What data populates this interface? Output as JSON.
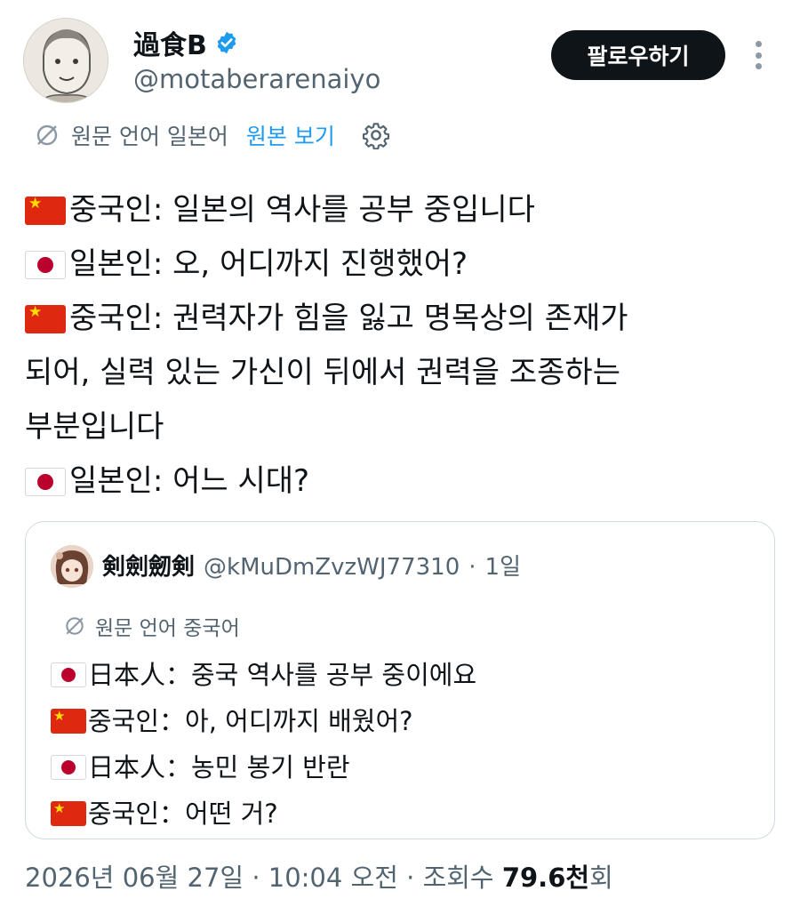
{
  "author": {
    "display_name": "過食B",
    "handle": "@motaberarenaiyo",
    "verified": true,
    "avatar_icon": "avatar-sketch"
  },
  "actions": {
    "follow_label": "팔로우하기",
    "more_icon": "more-vertical-icon"
  },
  "translation": {
    "label": "원문 언어 일본어",
    "show_original": "원본 보기",
    "icon": "no-translate-icon",
    "settings_icon": "gear-icon"
  },
  "tweet": {
    "lines": [
      {
        "flag": "china",
        "text": "중국인: 일본의 역사를 공부 중입니다"
      },
      {
        "flag": "japan",
        "text": "일본인: 오, 어디까지 진행했어?"
      },
      {
        "flag": "china",
        "text": "중국인: 권력자가 힘을 잃고 명목상의 존재가"
      },
      {
        "flag": "",
        "text": "되어, 실력 있는 가신이 뒤에서 권력을 조종하는"
      },
      {
        "flag": "",
        "text": "부분입니다"
      },
      {
        "flag": "japan",
        "text": "일본인: 어느 시대?"
      }
    ]
  },
  "quote": {
    "name": "剣劍劒剣",
    "handle": "@kMuDmZvzWJ77310",
    "separator": "·",
    "time": "1일",
    "translation_label": "원문 언어 중국어",
    "lines": [
      {
        "flag": "japan",
        "text": "日本人：중국 역사를 공부 중이에요"
      },
      {
        "flag": "china",
        "text": "중국인：아, 어디까지 배웠어?"
      },
      {
        "flag": "japan",
        "text": "日本人：농민 봉기 반란"
      },
      {
        "flag": "china",
        "text": "중국인：어떤 거?"
      }
    ]
  },
  "meta": {
    "date": "2026년 06월 27일",
    "sep1": "·",
    "time": "10:04 오전",
    "sep2": "·",
    "views_label": "조회수",
    "views_count": "79.6천",
    "views_suffix": "회"
  },
  "colors": {
    "accent": "#1d9bf0",
    "text": "#0f1419",
    "secondary": "#536471",
    "border": "#cfd9de"
  }
}
